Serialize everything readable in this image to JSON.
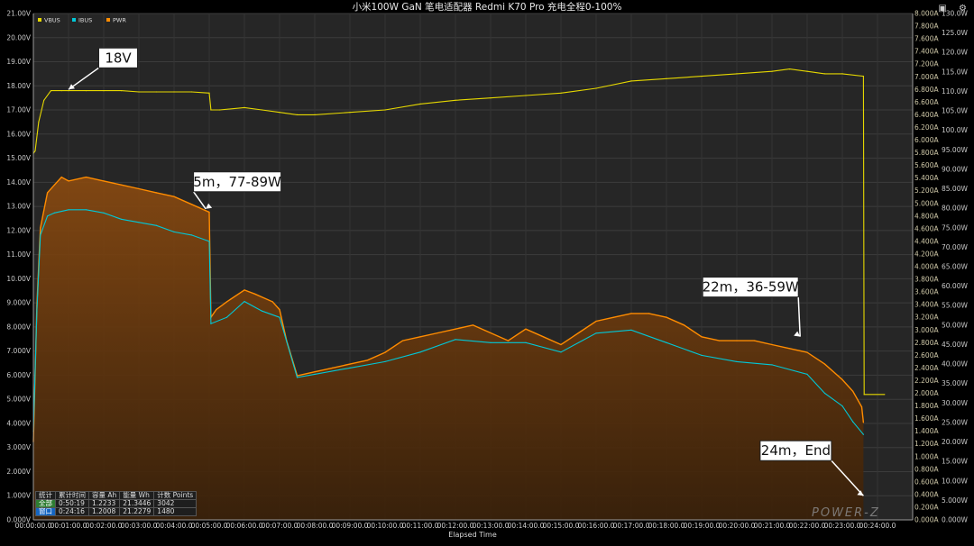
{
  "chart_data": {
    "type": "line",
    "title": "小米100W GaN 笔电适配器 Redmi K70 Pro 充电全程0-100%",
    "xlabel": "Elapsed Time",
    "legend": [
      {
        "name": "VBUS",
        "color": "#e6d800"
      },
      {
        "name": "IBUS",
        "color": "#00c8d8"
      },
      {
        "name": "PWR",
        "color": "#ff8c00"
      }
    ],
    "legend_position": "top-left",
    "grid": true,
    "x_range_min": [
      0,
      25
    ],
    "x_ticks": [
      "00:00:00.0",
      "00:01:00.0",
      "00:02:00.0",
      "00:03:00.0",
      "00:04:00.0",
      "00:05:00.0",
      "00:06:00.0",
      "00:07:00.0",
      "00:08:00.0",
      "00:09:00.0",
      "00:10:00.0",
      "00:11:00.0",
      "00:12:00.0",
      "00:13:00.0",
      "00:14:00.0",
      "00:15:00.0",
      "00:16:00.0",
      "00:17:00.0",
      "00:18:00.0",
      "00:19:00.0",
      "00:20:00.0",
      "00:21:00.0",
      "00:22:00.0",
      "00:23:00.0",
      "00:24:00.0"
    ],
    "y_left": {
      "unit": "V",
      "ylim": [
        0,
        21
      ],
      "ticks": [
        "0.000V",
        "1.000V",
        "2.000V",
        "3.000V",
        "4.000V",
        "5.000V",
        "6.000V",
        "7.000V",
        "8.000V",
        "9.000V",
        "10.00V",
        "11.00V",
        "12.00V",
        "13.00V",
        "14.00V",
        "15.00V",
        "16.00V",
        "17.00V",
        "18.00V",
        "19.00V",
        "20.00V",
        "21.00V"
      ]
    },
    "y_right_current": {
      "unit": "A",
      "ylim": [
        0,
        8
      ],
      "ticks": [
        "0.000A",
        "0.200A",
        "0.400A",
        "0.600A",
        "0.800A",
        "1.000A",
        "1.200A",
        "1.400A",
        "1.600A",
        "1.800A",
        "2.000A",
        "2.200A",
        "2.400A",
        "2.600A",
        "2.800A",
        "3.000A",
        "3.200A",
        "3.400A",
        "3.600A",
        "3.800A",
        "4.000A",
        "4.200A",
        "4.400A",
        "4.600A",
        "4.800A",
        "5.000A",
        "5.200A",
        "5.400A",
        "5.600A",
        "5.800A",
        "6.000A",
        "6.200A",
        "6.400A",
        "6.600A",
        "6.800A",
        "7.000A",
        "7.200A",
        "7.400A",
        "7.600A",
        "7.800A",
        "8.000A"
      ]
    },
    "y_right_power": {
      "unit": "W",
      "ylim": [
        0,
        130
      ],
      "ticks": [
        "0.000W",
        "5.000W",
        "10.00W",
        "15.00W",
        "20.00W",
        "25.00W",
        "30.00W",
        "35.00W",
        "40.00W",
        "45.00W",
        "50.00W",
        "55.00W",
        "60.00W",
        "65.00W",
        "70.00W",
        "75.00W",
        "80.00W",
        "85.00W",
        "90.00W",
        "95.00W",
        "100.0W",
        "105.0W",
        "110.0W",
        "115.0W",
        "120.0W",
        "125.0W",
        "130.0W"
      ]
    },
    "series": [
      {
        "name": "VBUS",
        "axis": "left",
        "x_min": [
          0,
          0.05,
          0.15,
          0.3,
          0.5,
          0.8,
          1.0,
          1.5,
          2.0,
          2.5,
          3.0,
          3.5,
          4.0,
          4.5,
          5.0,
          5.05,
          5.3,
          6.0,
          6.5,
          7.0,
          7.5,
          8.0,
          9.0,
          10.0,
          11.0,
          12.0,
          13.0,
          14.0,
          15.0,
          16.0,
          17.0,
          18.0,
          19.0,
          20.0,
          21.0,
          21.5,
          22.0,
          22.5,
          23.0,
          23.6,
          23.62,
          24.2
        ],
        "values": [
          15.2,
          15.3,
          16.5,
          17.4,
          17.8,
          17.8,
          17.8,
          17.8,
          17.8,
          17.8,
          17.75,
          17.75,
          17.75,
          17.75,
          17.7,
          17.0,
          17.0,
          17.1,
          17.0,
          16.9,
          16.8,
          16.8,
          16.9,
          17.0,
          17.25,
          17.4,
          17.5,
          17.6,
          17.7,
          17.9,
          18.2,
          18.3,
          18.4,
          18.5,
          18.6,
          18.7,
          18.6,
          18.5,
          18.5,
          18.4,
          5.2,
          5.2
        ]
      },
      {
        "name": "PWR",
        "axis": "power",
        "x_min": [
          0,
          0.1,
          0.2,
          0.4,
          0.6,
          0.8,
          1.0,
          1.5,
          2.0,
          2.5,
          3.0,
          3.5,
          4.0,
          4.5,
          5.0,
          5.05,
          5.2,
          5.5,
          6.0,
          6.3,
          6.8,
          7.0,
          7.2,
          7.5,
          8.0,
          8.5,
          9.0,
          9.5,
          10.0,
          10.5,
          11.0,
          11.5,
          12.0,
          12.5,
          13.0,
          13.5,
          14.0,
          14.5,
          15.0,
          15.5,
          16.0,
          16.5,
          17.0,
          17.5,
          18.0,
          18.5,
          19.0,
          19.5,
          20.0,
          20.5,
          21.0,
          21.5,
          22.0,
          22.5,
          23.0,
          23.3,
          23.55,
          23.6
        ],
        "values": [
          20,
          55,
          75,
          84,
          86,
          88,
          87,
          88,
          87,
          86,
          85,
          84,
          83,
          81,
          79,
          52,
          54,
          56,
          59,
          58,
          56,
          54,
          46,
          37,
          38,
          39,
          40,
          41,
          43,
          46,
          47,
          48,
          49,
          50,
          48,
          46,
          49,
          47,
          45,
          48,
          51,
          52,
          53,
          53,
          52,
          50,
          47,
          46,
          46,
          46,
          45,
          44,
          43,
          40,
          36,
          33,
          29,
          25
        ]
      },
      {
        "name": "IBUS",
        "axis": "current",
        "x_min": [
          0,
          0.1,
          0.2,
          0.4,
          0.6,
          1.0,
          1.5,
          2.0,
          2.5,
          3.0,
          3.5,
          4.0,
          4.5,
          5.0,
          5.05,
          5.5,
          6.0,
          6.5,
          7.0,
          7.5,
          8.0,
          9.0,
          10.0,
          11.0,
          12.0,
          13.0,
          14.0,
          15.0,
          16.0,
          17.0,
          18.0,
          19.0,
          20.0,
          21.0,
          22.0,
          22.5,
          23.0,
          23.3,
          23.6
        ],
        "values": [
          1.4,
          3.3,
          4.5,
          4.8,
          4.85,
          4.9,
          4.9,
          4.85,
          4.75,
          4.7,
          4.65,
          4.55,
          4.5,
          4.4,
          3.1,
          3.2,
          3.45,
          3.3,
          3.2,
          2.25,
          2.3,
          2.4,
          2.5,
          2.65,
          2.85,
          2.8,
          2.8,
          2.65,
          2.95,
          3.0,
          2.8,
          2.6,
          2.5,
          2.45,
          2.3,
          2.0,
          1.8,
          1.55,
          1.35
        ]
      }
    ],
    "annotations": [
      {
        "text": "18V",
        "x_min": 1.0,
        "value": 17.85,
        "axis": "left"
      },
      {
        "text": "5m，77-89W",
        "x_min": 4.9,
        "value": 12.9,
        "axis": "left"
      },
      {
        "text": "22m，36-59W",
        "x_min": 21.8,
        "value": 7.6,
        "axis": "left"
      },
      {
        "text": "24m，End",
        "x_min": 23.6,
        "value": 1.0,
        "axis": "left"
      }
    ]
  },
  "stats_table": {
    "header": [
      "统计",
      "累计时间",
      "容量 Ah",
      "能量 Wh",
      "计数 Points"
    ],
    "rows": [
      [
        "全部",
        "0:50:19",
        "1.2233",
        "21.3446",
        "3042"
      ],
      [
        "窗口",
        "0:24:16",
        "1.2008",
        "21.2279",
        "1480"
      ]
    ]
  },
  "watermark": "POWER-Z",
  "window_icons": [
    "camera-icon",
    "gear-icon"
  ]
}
